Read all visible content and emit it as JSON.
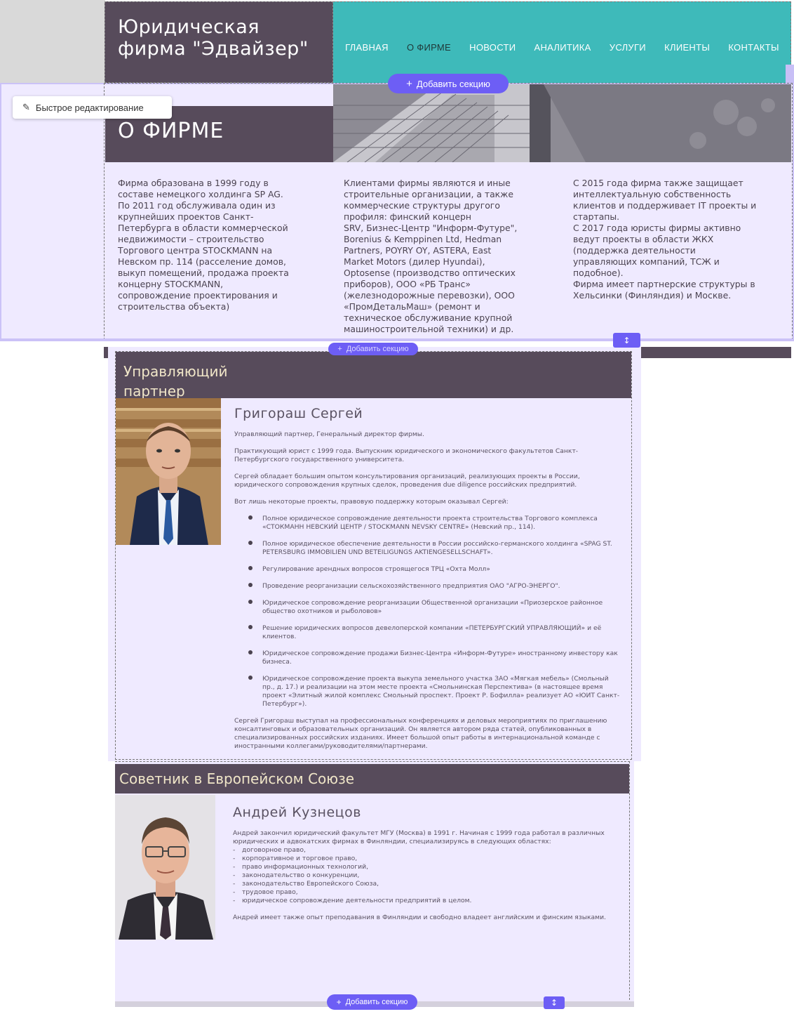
{
  "header": {
    "brand_title": "Юридическая фирма \"Эдвайзер\"",
    "nav": [
      "ГЛАВНАЯ",
      "О ФИРМЕ",
      "НОВОСТИ",
      "АНАЛИТИКА",
      "УСЛУГИ",
      "КЛИЕНТЫ",
      "КОНТАКТЫ"
    ],
    "active_nav": "О ФИРМЕ"
  },
  "editor": {
    "add_section_label": "Добавить секцию",
    "add_section_plus": "+",
    "quick_edit_label": "Быстрое редактирование",
    "move_glyph": "↕",
    "pencil_glyph": "✎"
  },
  "about": {
    "title": "О ФИРМЕ",
    "col1": "Фирма образована в 1999 году в\nсоставе немецкого холдинга SP AG.\nПо 2011 год обслуживала один из\nкрупнейших проектов Санкт-\nПетербурга в области коммерческой\nнедвижимости – строительство\nТоргового центра STOCKMANN на\nНевском пр. 114 (расселение домов,\nвыкуп помещений, продажа проекта\nконцерну STOCKMANN,\nсопровождение проектирования и\nстроительства объекта)",
    "col2": "Клиентами фирмы являются и иные\nстроительные организации, а также\nкоммерческие структуры другого\nпрофиля: финский концерн\nSRV, Бизнес-Центр \"Информ-Футуре\",\nBorenius & Kemppinen Ltd, Hedman\nPartners, POYRY OY, ASTERA, East\nMarket Motors (дилер Hyundai),\nOptosense (производство оптических\nприборов), ООО «РБ Транс»\n(железнодорожные перевозки), ООО\n«ПромДетальМаш» (ремонт и\nтехническое обслуживание крупной\nмашиностроительной техники) и др.",
    "col3": "С 2015 года фирма также защищает\nинтеллектуальную собственность\nклиентов и поддерживает IT проекты и\nстартапы.\nС 2017 года юристы фирмы активно\nведут проекты в области ЖКХ\n(поддержка деятельности\nуправляющих компаний, ТСЖ и\nподобное).\nФирма имеет партнерские структуры в\nХельсинки (Финляндия) и Москве."
  },
  "partner": {
    "heading": "Управляющий\nпартнер",
    "name": "Григораш Сергей",
    "intro": [
      "Управляющий партнер, Генеральный директор фирмы.",
      "Практикующий юрист с 1999 года. Выпускник юридического и экономического факультетов Санкт-\nПетербургского государственного университета.",
      "Сергей обладает большим опытом консультирования организаций, реализующих проекты в России,\nюридического сопровождения крупных сделок, проведения due diligence российских предприятий.",
      "Вот лишь некоторые проекты, правовую поддержку которым оказывал Сергей:"
    ],
    "projects": [
      "Полное юридическое сопровождение деятельности проекта строительства Торгового комплекса\n«СТОКМАНН НЕВСКИЙ ЦЕНТР / STOCKMANN NEVSKY CENTRE» (Невский пр., 114).",
      "Полное юридическое обеспечение деятельности в России российско-германского холдинга «SPAG ST.\nPETERSBURG IMMOBILIEN UND BETEILIGUNGS AKTIENGESELLSCHAFT».",
      "Регулирование арендных вопросов строящегося ТРЦ «Охта Молл»",
      "Проведение реорганизации сельскохозяйственного предприятия ОАО \"АГРО-ЭНЕРГО\".",
      "Юридическое сопровождение реорганизации Общественной организации «Приозерское районное\nобщество охотников и рыболовов»",
      "Решение юридических вопросов девелоперской компании «ПЕТЕРБУРГСКИЙ УПРАВЛЯЮЩИЙ» и её\nклиентов.",
      "Юридическое сопровождение продажи Бизнес-Центра «Информ-Футуре» иностранному инвестору как\nбизнеса.",
      "Юридическое сопровождение проекта выкупа земельного участка ЗАО «Мягкая мебель» (Смольный\nпр., д. 17.) и реализации на этом месте проекта «Смольнинская Перспектива» (в настоящее время\nпроект «Элитный жилой комплекс Смольный проспект. Проект Р. Бофилла» реализует АО «ЮИТ Санкт-\nПетербург»)."
    ],
    "outro": "Сергей Григораш выступал на профессиональных конференциях и деловых мероприятиях по приглашению\nконсалтинговых и образовательных организаций. Он является автором ряда статей, опубликованных в\nспециализированных российских изданиях. Имеет большой опыт работы в интернациональной команде с\nиностранными коллегами/руководителями/партнерами."
  },
  "advisor": {
    "heading": "Советник в Европейском Союзе",
    "name": "Андрей Кузнецов",
    "intro": "Андрей закончил юридический факультет МГУ (Москва) в 1991 г. Начиная с 1999 года работал в различных\nюридических и адвокатских фирмах в Финляндии, специализируясь в следующих областях:",
    "areas": [
      "договорное право,",
      "корпоративное и торговое право,",
      "право информационных технологий,",
      "законодательство о конкуренции,",
      "законодательство Европейского Союза,",
      "трудовое право,",
      "юридическое сопровождение деятельности предприятий в целом."
    ],
    "dash_glyph": "-",
    "outro": "Андрей имеет также опыт преподавания в Финляндии и свободно владеет английским и финским языками."
  },
  "colors": {
    "brand_purple": "#574b5b",
    "nav_teal": "#3ebaba",
    "section_bg": "#efeaff",
    "editor_accent": "#6d5ef5",
    "heading_cream": "#f0e6c8"
  }
}
